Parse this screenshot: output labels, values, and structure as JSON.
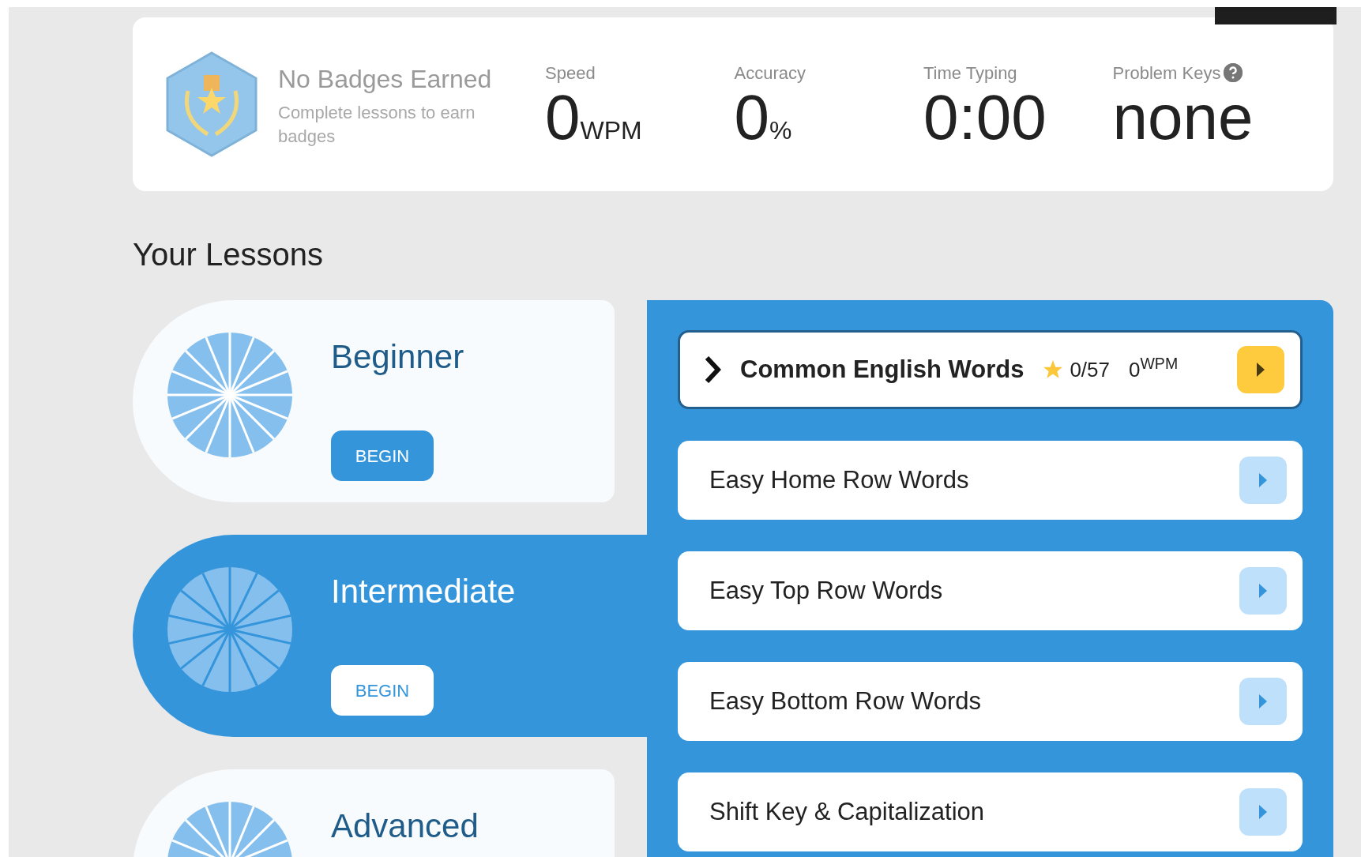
{
  "badges": {
    "title": "No Badges Earned",
    "subtitle": "Complete lessons to earn badges"
  },
  "stats": [
    {
      "label": "Speed",
      "value": "0",
      "unit": "WPM",
      "help": false
    },
    {
      "label": "Accuracy",
      "value": "0",
      "unit": "%",
      "help": false
    },
    {
      "label": "Time Typing",
      "value": "0:00",
      "help": false
    },
    {
      "label": "Problem Keys",
      "value": "none",
      "help": true
    }
  ],
  "lessons_heading": "Your Lessons",
  "levels": [
    {
      "name": "Beginner",
      "button": "BEGIN",
      "selected": false
    },
    {
      "name": "Intermediate",
      "button": "BEGIN",
      "selected": true
    },
    {
      "name": "Advanced",
      "selected": false
    }
  ],
  "lessons": [
    {
      "name": "Common English Words",
      "selected": true,
      "stars": "0/57",
      "wpm": "0",
      "wpm_unit": "WPM"
    },
    {
      "name": "Easy Home Row Words",
      "selected": false
    },
    {
      "name": "Easy Top Row Words",
      "selected": false
    },
    {
      "name": "Easy Bottom Row Words",
      "selected": false
    },
    {
      "name": "Shift Key & Capitalization",
      "selected": false
    }
  ]
}
